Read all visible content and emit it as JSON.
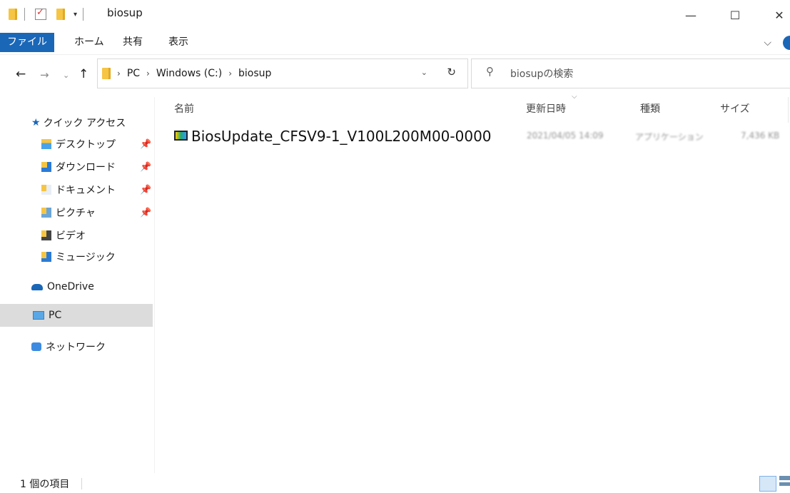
{
  "window": {
    "title": "biosup",
    "minimize": "—",
    "maximize": "☐",
    "close": "✕"
  },
  "ribbon": {
    "tabs": [
      "ファイル",
      "ホーム",
      "共有",
      "表示"
    ]
  },
  "address": {
    "crumbs": [
      "PC",
      "Windows (C:)",
      "biosup"
    ]
  },
  "search": {
    "placeholder": "biosupの検索"
  },
  "sidebar": {
    "quick_access": "クイック アクセス",
    "items": [
      {
        "label": "デスクトップ",
        "pinned": true
      },
      {
        "label": "ダウンロード",
        "pinned": true
      },
      {
        "label": "ドキュメント",
        "pinned": true
      },
      {
        "label": "ピクチャ",
        "pinned": true
      },
      {
        "label": "ビデオ",
        "pinned": false
      },
      {
        "label": "ミュージック",
        "pinned": false
      }
    ],
    "onedrive": "OneDrive",
    "pc": "PC",
    "network": "ネットワーク"
  },
  "columns": {
    "name": "名前",
    "date": "更新日時",
    "type": "種類",
    "size": "サイズ"
  },
  "files": [
    {
      "name": "BiosUpdate_CFSV9-1_V100L200M00-0000",
      "date": "2021/04/05 14:09",
      "type": "アプリケーション",
      "size": "7,436 KB"
    }
  ],
  "status": {
    "item_count": "1 個の項目"
  },
  "colors": {
    "accent": "#1a67b8",
    "selected_bg": "#dcdcdc",
    "folder": "#f6c544"
  }
}
